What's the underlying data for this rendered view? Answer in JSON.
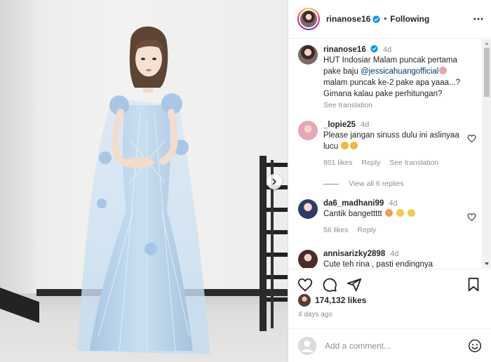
{
  "post": {
    "username": "rinanose16",
    "follow_status": "Following",
    "caption": {
      "time": "4d",
      "text_before": "HUT Indosiar Malam puncak pertama pake baju ",
      "mention": "@jessicahuangofficial",
      "text_after": " malam puncak ke-2 pake apa yaaa...? Gimana kalau pake perhitungan?",
      "see_translation": "See translation"
    },
    "likes": "174,132 likes",
    "posted_ago": "4 days ago"
  },
  "comments": [
    {
      "username": "_lopie25",
      "time": "4d",
      "text": "Please jangan sinuss dulu ini aslinyaa lucu",
      "likes": "801 likes",
      "reply": "Reply",
      "see_translation": "See translation",
      "view_replies": "View all 6 replies"
    },
    {
      "username": "da6_madhani99",
      "time": "4d",
      "text": "Cantik bangettttt",
      "likes": "56 likes",
      "reply": "Reply"
    },
    {
      "username": "annisarizky2898",
      "time": "4d",
      "text": "Cute teh rina , pasti endingnya"
    }
  ],
  "add_comment": {
    "placeholder": "Add a comment..."
  },
  "colors": {
    "verified": "#0095f6",
    "dress": "#b9d6ec",
    "mention": "#00376b"
  },
  "icons": [
    "verified-badge-icon",
    "more-options-icon",
    "heart-icon",
    "comment-icon",
    "share-icon",
    "bookmark-icon",
    "emoji-icon",
    "chevron-right-icon"
  ]
}
